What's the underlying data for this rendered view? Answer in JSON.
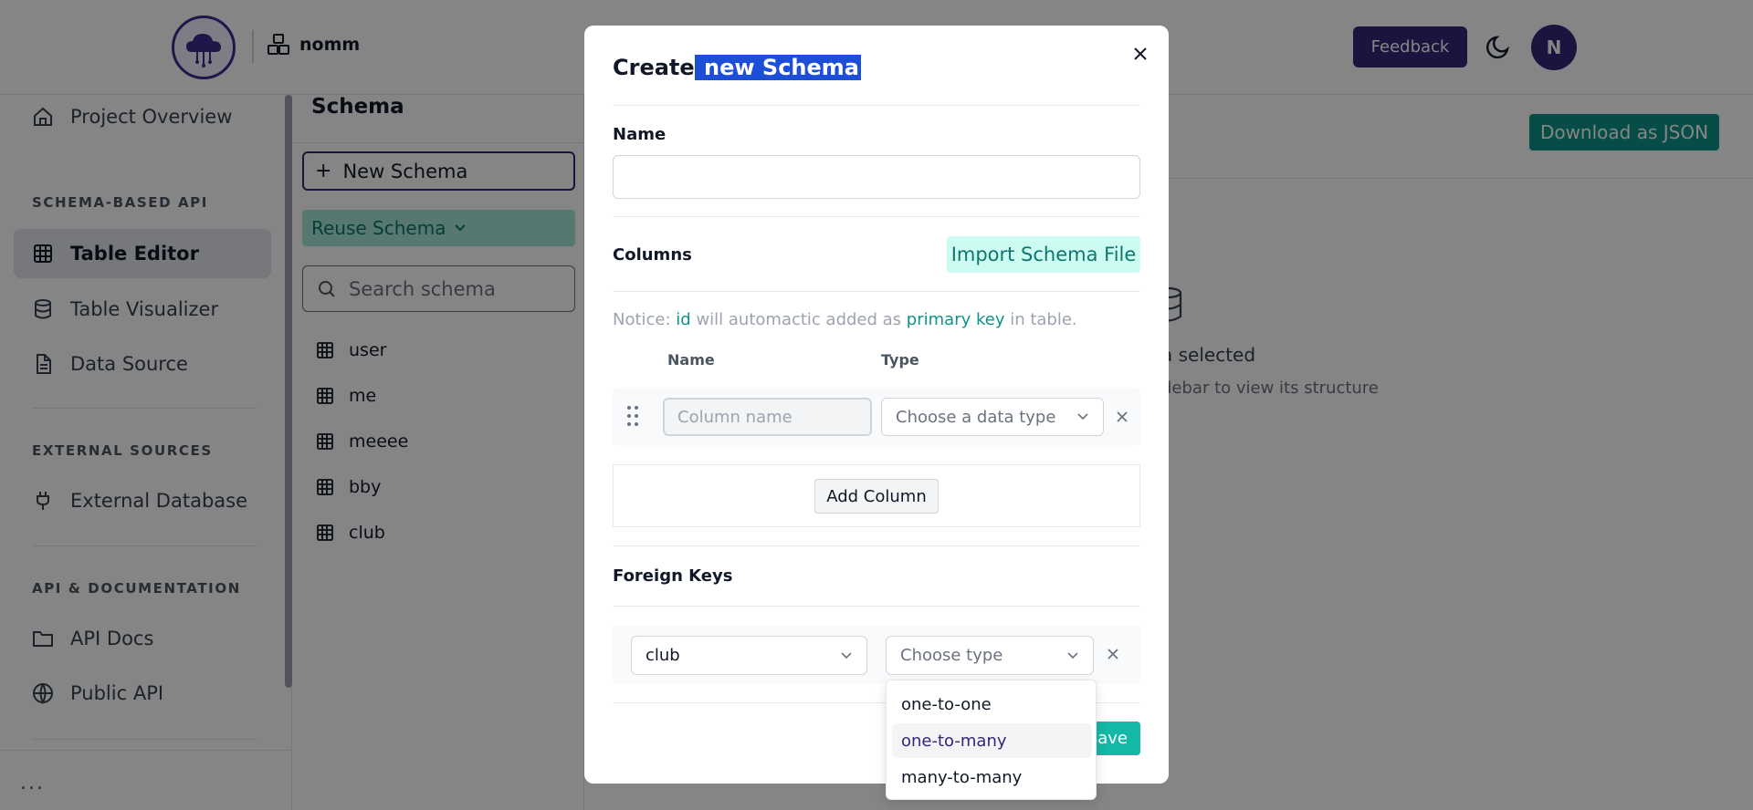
{
  "header": {
    "project_name": "nomm",
    "feedback_label": "Feedback",
    "avatar_initial": "N"
  },
  "sidebar": {
    "items_top": [
      {
        "label": "Project Overview",
        "icon": "home-icon"
      }
    ],
    "sections": [
      {
        "title": "SCHEMA-BASED API",
        "items": [
          {
            "label": "Table Editor",
            "icon": "table-icon",
            "active": true
          },
          {
            "label": "Table Visualizer",
            "icon": "database-icon"
          },
          {
            "label": "Data Source",
            "icon": "file-icon"
          }
        ]
      },
      {
        "title": "EXTERNAL SOURCES",
        "items": [
          {
            "label": "External Database",
            "icon": "plug-icon"
          }
        ]
      },
      {
        "title": "API & DOCUMENTATION",
        "items": [
          {
            "label": "API Docs",
            "icon": "folder-icon"
          },
          {
            "label": "Public API",
            "icon": "globe-icon"
          }
        ]
      }
    ],
    "more_label": "..."
  },
  "schema_panel": {
    "title": "Schema",
    "new_schema_label": "New Schema",
    "reuse_label": "Reuse Schema",
    "search_placeholder": "Search schema",
    "schemas": [
      "user",
      "me",
      "meeee",
      "bby",
      "club"
    ]
  },
  "main": {
    "download_label": "Download as JSON",
    "empty_title_fragment": "a selected",
    "empty_sub_fragment": "debar to view its structure"
  },
  "modal": {
    "title_prefix": "Create",
    "title_highlight": " new Schema",
    "name_label": "Name",
    "name_value": "",
    "columns_label": "Columns",
    "import_label": "Import Schema File",
    "notice": {
      "prefix": "Notice: ",
      "id": "id",
      "mid": " will automactic added as ",
      "primary_key": "primary key",
      "suffix": " in table."
    },
    "column_headers": {
      "name": "Name",
      "type": "Type"
    },
    "column_name_placeholder": "Column name",
    "data_type_placeholder": "Choose a data type",
    "add_column_label": "Add Column",
    "foreign_keys_label": "Foreign Keys",
    "fk_table_value": "club",
    "fk_type_placeholder": "Choose type",
    "type_options": [
      "one-to-one",
      "one-to-many",
      "many-to-many"
    ],
    "type_option_highlighted": "one-to-many",
    "save_label": "Save"
  },
  "colors": {
    "brand": "#33277a",
    "teal": "#0f9488",
    "teal_light": "#ccfbf1",
    "save": "#14b8a6",
    "highlight": "#1d4ed8"
  }
}
